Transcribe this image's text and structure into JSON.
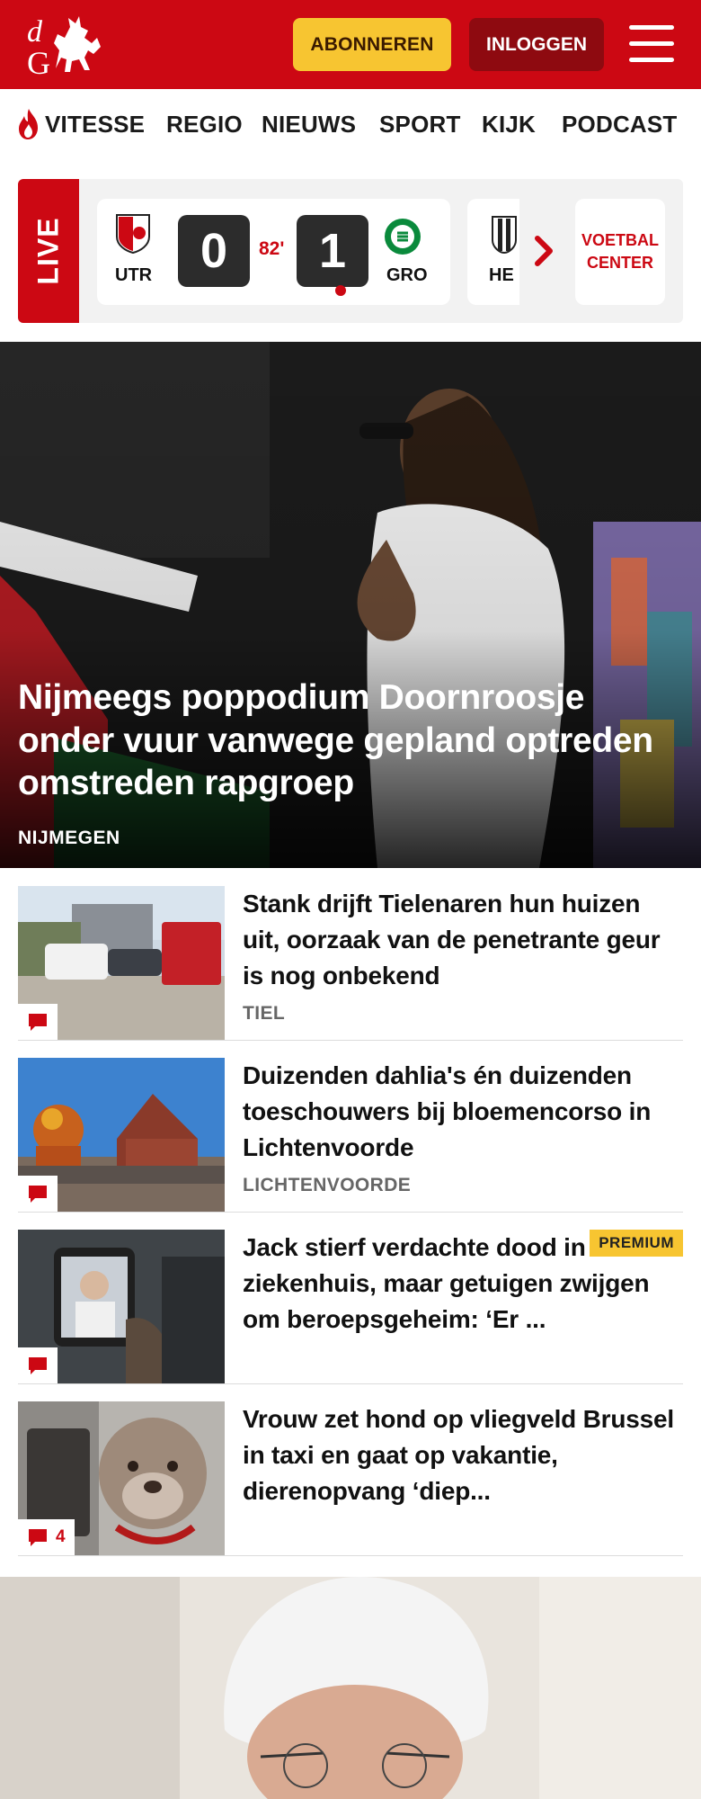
{
  "header": {
    "logo_text": "dG",
    "subscribe_label": "ABONNEREN",
    "login_label": "INLOGGEN",
    "brand_color": "#cc0813"
  },
  "nav": {
    "items": [
      {
        "label": "VITESSE",
        "icon": "flame-icon"
      },
      {
        "label": "REGIO"
      },
      {
        "label": "NIEUWS"
      },
      {
        "label": "SPORT"
      },
      {
        "label": "KIJK"
      },
      {
        "label": "PODCAST"
      }
    ]
  },
  "live": {
    "label": "LIVE",
    "match": {
      "home": "UTR",
      "away": "GRO",
      "home_score": "0",
      "away_score": "1",
      "minute": "82'"
    },
    "next_match": {
      "home": "HE"
    },
    "voetbal_center_line1": "VOETBAL",
    "voetbal_center_line2": "CENTER"
  },
  "hero": {
    "title": "Nijmeegs poppodium Doornroosje onder vuur vanwege gepland optreden omstreden rapgroep",
    "location": "NIJMEGEN"
  },
  "articles": [
    {
      "title": "Stank drijft Tielenaren hun huizen uit, oorzaak van de penetrante geur is nog onbekend",
      "location": "TIEL",
      "comments": "",
      "premium": false
    },
    {
      "title": "Duizenden dahlia's én duizenden toeschouwers bij bloemencorso in Lichtenvoorde",
      "location": "LICHTENVOORDE",
      "comments": "",
      "premium": false
    },
    {
      "title": "Jack stierf verdachte dood in ziekenhuis, maar getuigen zwijgen om beroepsgeheim: ‘Er ...",
      "location": "",
      "comments": "",
      "premium": true,
      "premium_label": "PREMIUM"
    },
    {
      "title": "Vrouw zet hond op vliegveld Brussel in taxi en gaat op vakantie, dierenopvang ‘diep...",
      "location": "",
      "comments": "4",
      "premium": false
    }
  ]
}
